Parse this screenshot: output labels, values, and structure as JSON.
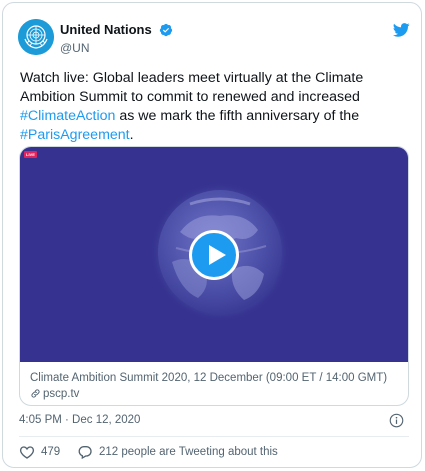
{
  "author": {
    "display_name": "United Nations",
    "handle": "@UN",
    "avatar_icon": "un-emblem-icon",
    "verified_icon": "verified-badge-icon"
  },
  "tweet": {
    "text_segments": {
      "t1": "Watch live: Global leaders meet virtually at the Climate Ambition Summit to commit to renewed and increased ",
      "h1": "#ClimateAction",
      "t2": " as we mark the fifth anniversary of the ",
      "h2": "#ParisAgreement",
      "t3": "."
    },
    "timestamp": "4:05 PM · Dec 12, 2020"
  },
  "media_card": {
    "live_badge": "LIVE",
    "title": "Climate Ambition Summit 2020, 12 December (09:00 ET / 14:00 GMT)",
    "link": "pscp.tv",
    "background_color": "#35338f"
  },
  "actions": {
    "likes": "479",
    "tweeting_about": "212 people are Tweeting about this"
  },
  "colors": {
    "accent": "#1d9bf0",
    "muted_text": "#536471",
    "like_red": "#e0245e"
  }
}
